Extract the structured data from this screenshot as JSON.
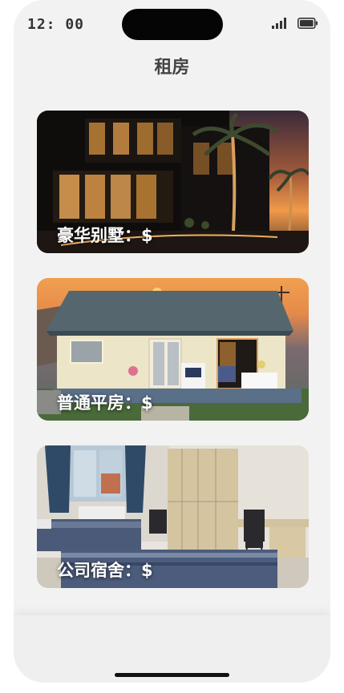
{
  "status_bar": {
    "time": "12: 00",
    "icons": [
      "signal-icon",
      "battery-icon"
    ]
  },
  "header": {
    "title": "租房"
  },
  "cards": [
    {
      "label": "豪华别墅：$",
      "image": "luxury-villa-photo"
    },
    {
      "label": "普通平房：$",
      "image": "bungalow-photo"
    },
    {
      "label": "公司宿舍：$",
      "image": "dormitory-photo"
    }
  ],
  "colors": {
    "background": "#f2f2f2",
    "title_text": "#444444",
    "card_label_text": "#ffffff"
  }
}
